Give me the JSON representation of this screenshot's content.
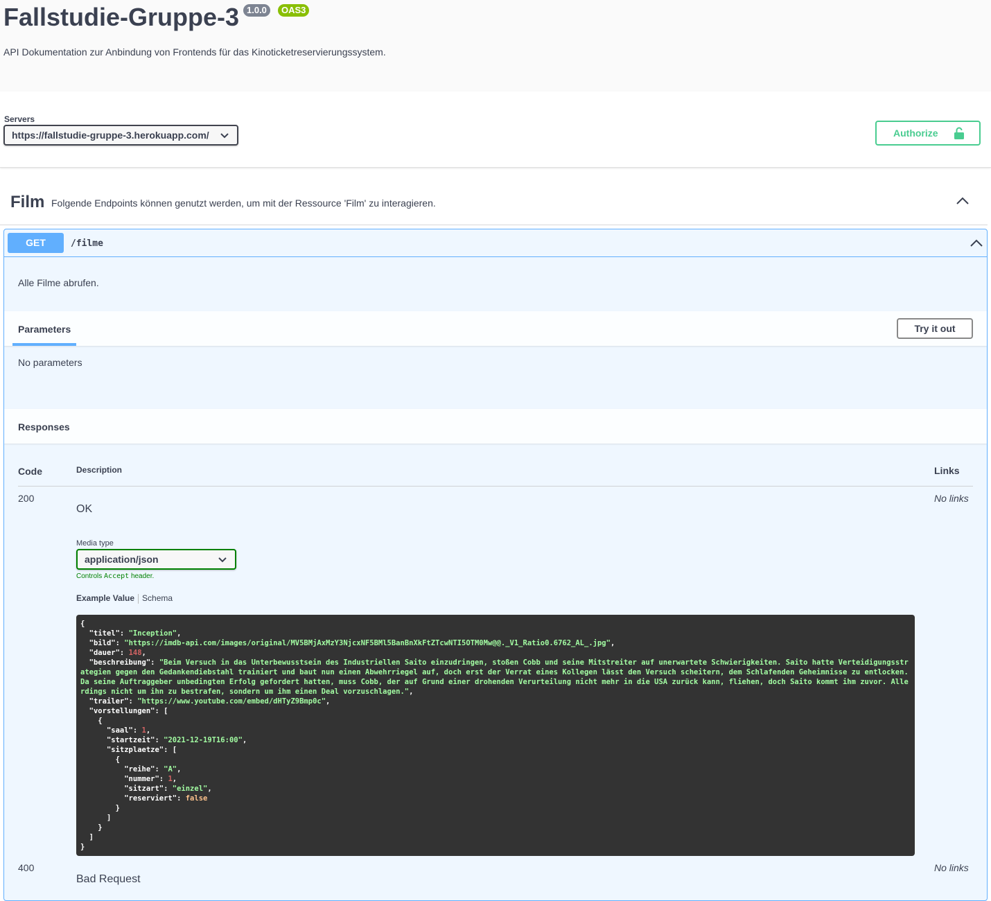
{
  "info": {
    "title": "Fallstudie-Gruppe-3",
    "version": "1.0.0",
    "oas": "OAS3",
    "description": "API Dokumentation zur Anbindung von Frontends für das Kinoticketreservierungssystem."
  },
  "servers": {
    "label": "Servers",
    "selected": "https://fallstudie-gruppe-3.herokuapp.com/"
  },
  "authorize": {
    "label": "Authorize"
  },
  "tag": {
    "name": "Film",
    "description": "Folgende Endpoints können genutzt werden, um mit der Ressource 'Film' zu interagieren."
  },
  "operation": {
    "method": "GET",
    "path": "/filme",
    "description": "Alle Filme abrufen.",
    "parameters_title": "Parameters",
    "try_label": "Try it out",
    "no_params": "No parameters",
    "responses_title": "Responses"
  },
  "responses": {
    "headers": {
      "code": "Code",
      "description": "Description",
      "links": "Links"
    },
    "items": [
      {
        "code": "200",
        "description": "OK",
        "links": "No links"
      },
      {
        "code": "400",
        "description": "Bad Request",
        "links": "No links"
      }
    ],
    "media_type_label": "Media type",
    "media_type": "application/json",
    "controls_prefix": "Controls",
    "controls_code": "Accept",
    "controls_suffix": "header.",
    "example_tab": "Example Value",
    "schema_tab": "Schema"
  },
  "example": {
    "titel": "Inception",
    "bild": "https://imdb-api.com/images/original/MV5BMjAxMzY3NjcxNF5BMl5BanBnXkFtZTcwNTI5OTM0Mw@@._V1_Ratio0.6762_AL_.jpg",
    "dauer": "148",
    "beschreibung": "Beim Versuch in das Unterbewusstsein des Industriellen Saito einzudringen, stoßen Cobb und seine Mitstreiter auf unerwartete Schwierigkeiten. Saito hatte Verteidigungsstrategien gegen den Gedankendiebstahl trainiert und baut nun einen Abwehrriegel auf, doch erst der Verrat eines Kollegen lässt den Versuch scheitern, dem Schlafenden Geheimnisse zu entlocken. Da seine Auftraggeber unbedingten Erfolg gefordert hatten, muss Cobb, der auf Grund einer drohenden Verurteilung nicht mehr in die USA zurück kann, fliehen, doch Saito kommt ihm zuvor. Allerdings nicht um ihn zu bestrafen, sondern um ihm einen Deal vorzuschlagen.",
    "trailer": "https://www.youtube.com/embed/dHTyZ9Bmp0c",
    "saal": "1",
    "startzeit": "2021-12-19T16:00",
    "reihe": "A",
    "nummer": "1",
    "sitzart": "einzel",
    "reserviert": "false"
  }
}
